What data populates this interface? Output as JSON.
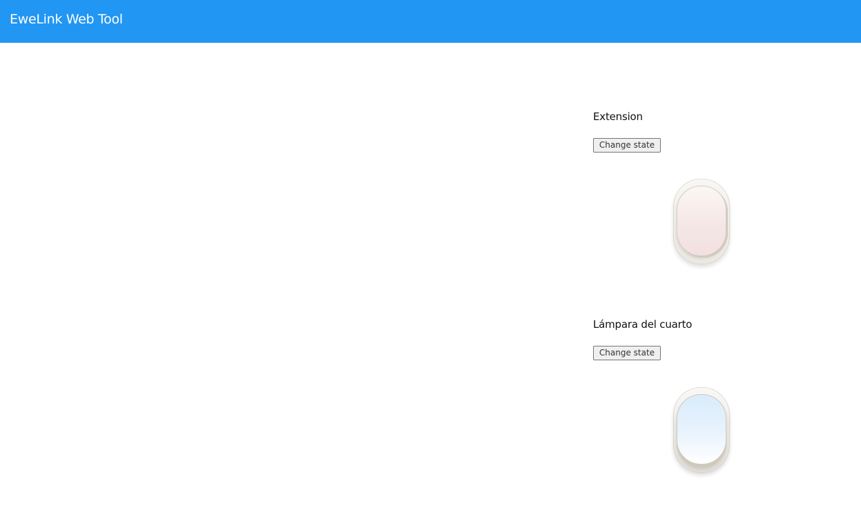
{
  "header": {
    "title": "EweLink Web Tool",
    "background_color": "#2196f3"
  },
  "devices": [
    {
      "name": "Extension",
      "button_label": "Change state",
      "state": "off",
      "rocker_color": "#f3e0e0"
    },
    {
      "name": "Lámpara del cuarto",
      "button_label": "Change state",
      "state": "on",
      "rocker_color": "#d9ecfb"
    }
  ]
}
